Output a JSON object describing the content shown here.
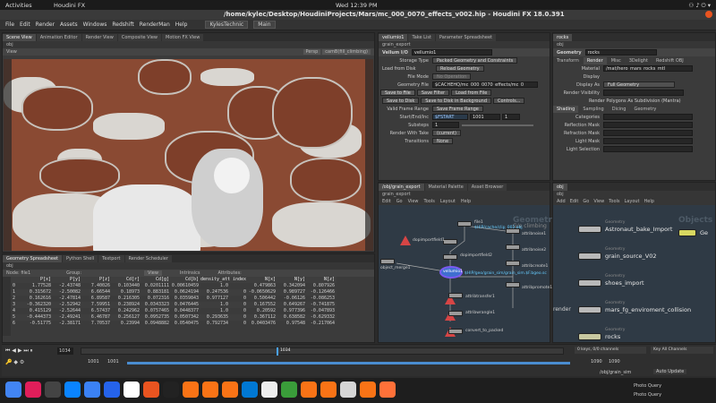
{
  "system": {
    "activities": "Activities",
    "app_name": "Houdini FX",
    "clock": "Wed 12:39 PM"
  },
  "window": {
    "title": "/home/kylec/Desktop/HoudiniProjects/Mars/mc_000_0070_effects_v002.hip - Houdini FX 18.0.391"
  },
  "menu": {
    "items": [
      "File",
      "Edit",
      "Render",
      "Assets",
      "Windows",
      "Redshift",
      "RenderMan",
      "Help"
    ],
    "desktop": "KylesTechnic",
    "desktop2": "Main"
  },
  "viewport_pane": {
    "tabs": [
      "Scene View",
      "Animation Editor",
      "Render View",
      "Composite View",
      "Motion FX View"
    ],
    "path": "obj",
    "header": "View",
    "persp": "Persp",
    "camera": "camB(fill_climbing)"
  },
  "spreadsheet": {
    "tabs": [
      "Geometry Spreadsheet",
      "Python Shell",
      "Textport",
      "Render Scheduler"
    ],
    "path": "obj",
    "node_label": "Node: file1",
    "group_label": "Group:",
    "view_label": "View",
    "intrinsics_label": "Intrinsics",
    "attributes_label": "Attributes:",
    "columns": [
      "",
      "P[x]",
      "P[y]",
      "P[z]",
      "Cd[r]",
      "Cd[g]",
      "Cd[b]",
      "density_attrib",
      "index",
      "N[x]",
      "N[y]",
      "N[z]"
    ],
    "rows": [
      [
        "0",
        "1.77528",
        "-2.43748",
        "7.40026",
        "0.103440",
        "0.0201111",
        "0.00610459",
        "1.0",
        "",
        "0.479863",
        "0.342094",
        "0.807926"
      ],
      [
        "1",
        "0.315672",
        "-2.50082",
        "6.66544",
        "0.18973",
        "0.883181",
        "0.0624194",
        "0.247536",
        "0",
        "-0.0650629",
        "0.989727",
        "-0.126466"
      ],
      [
        "2",
        "0.162616",
        "-2.47814",
        "6.89587",
        "0.216305",
        "0.072316",
        "0.0359843",
        "0.977127",
        "0",
        "0.506442",
        "-0.06126",
        "-0.086253"
      ],
      [
        "3",
        "-0.362320",
        "-2.52942",
        "7.59951",
        "0.238924",
        "0.0343323",
        "0.0476445",
        "1.0",
        "0",
        "0.167552",
        "0.649267",
        "-0.741875"
      ],
      [
        "4",
        "0.415129",
        "-2.52644",
        "6.57437",
        "0.242962",
        "0.0757465",
        "0.0448377",
        "1.0",
        "0",
        "0.20592",
        "0.977396",
        "-0.047893"
      ],
      [
        "5",
        "-0.444373",
        "-2.49241",
        "6.46787",
        "0.256127",
        "0.0952735",
        "0.0507342",
        "0.293635",
        "0",
        "0.367112",
        "0.638582",
        "-0.629332"
      ],
      [
        "6",
        "-0.51775",
        "-2.38171",
        "7.70537",
        "0.23994",
        "0.0948882",
        "0.0540475",
        "0.792734",
        "0",
        "0.0403476",
        "0.97548",
        "-0.217064"
      ]
    ]
  },
  "timeline": {
    "current_frame": "1034",
    "start": "1001",
    "start2": "1001",
    "end": "1090",
    "end2": "1090",
    "tick_marker": "1034",
    "keys": "0 keys, 0/0 channels",
    "key_all": "Key All Channels",
    "auto_update": "Auto Update",
    "path": "/obj/grain_sim"
  },
  "params": {
    "tabs": [
      "vellumio1",
      "Take List",
      "Parameter Spreadsheet"
    ],
    "path": "grain_export",
    "node_type": "Vellum I/O",
    "node_name": "vellumio1",
    "storage_type_label": "Storage Type",
    "storage_type": "Packed Geometry and Constraints",
    "load_from_disk": "Load from Disk",
    "reload_geometry": "Reload Geometry",
    "file_mode_label": "File Mode",
    "file_mode": "No Operation",
    "geometry_file_label": "Geometry File",
    "geometry_file": "$CACHEHQ/mc_000_0070_effects/mc_0",
    "save_to_file": "Save to File",
    "save_filter": "Save Filter",
    "load_from_file": "Load from File",
    "save_to_disk": "Save to Disk",
    "save_bg": "Save to Disk in Background",
    "controls": "Controls...",
    "valid_frame_label": "Valid Frame Range",
    "valid_frame": "Save Frame Range",
    "start_end_label": "Start/End/Inc",
    "start_expr": "$FSTART",
    "end_val": "1001",
    "inc_val": "1",
    "substeps_label": "Substeps",
    "substeps": "1",
    "render_take_label": "Render With Take",
    "render_take": "(current)",
    "transitions_label": "Transitions",
    "transitions": "None"
  },
  "material_pane": {
    "tabs": [
      "rocks"
    ],
    "path": "obj",
    "node_type": "Geometry",
    "node_name": "rocks",
    "subtabs": [
      "Transform",
      "Render",
      "Misc",
      "3Delight",
      "Redshift OBJ"
    ],
    "material_label": "Material",
    "material": "/mat/hero_mars_rocks_mtl",
    "display_label": "Display",
    "display_as_label": "Display As",
    "display_as": "Full Geometry",
    "render_vis_label": "Render Visibility",
    "render_poly": "Render Polygons As Subdivision (Mantra)",
    "shade_tabs": [
      "Shading",
      "Sampling",
      "Dicing",
      "Geometry"
    ],
    "categories_label": "Categories",
    "reflection_label": "Reflection Mask",
    "refraction_label": "Refraction Mask",
    "light_label": "Light Mask",
    "light_sel_label": "Light Selection"
  },
  "sop_network": {
    "tabs": [
      "/obj/grain_export",
      "Material Palette",
      "Asset Browser"
    ],
    "path": "grain_export",
    "menu": [
      "Edit",
      "Go",
      "View",
      "Tools",
      "Layout",
      "Help"
    ],
    "watermark": "Geometry",
    "watermark2": "G/e climbing",
    "nodes": [
      "file1",
      "dopimportfield1",
      "dopimportfield2",
      "vellumio1",
      "attribnoise1",
      "attribnoise2",
      "attribcreate1",
      "attribtransfer1",
      "attribpromote1",
      "attribwrangle1",
      "convert_to_packed",
      "object_merge1"
    ],
    "file1_sub": "$HIP/cache/clip_002.obj",
    "vellum_sub": "$HIP/geo/grain_sim/grain_sim.$F.bgeo.sc"
  },
  "obj_network": {
    "tabs": [
      "obj"
    ],
    "path": "obj",
    "menu": [
      "Add",
      "Edit",
      "Go",
      "View",
      "Tools",
      "Layout",
      "Help"
    ],
    "watermark": "Objects",
    "render_label": "render",
    "objects": [
      {
        "tag": "Geometry",
        "name": "Astronaut_bake_Import"
      },
      {
        "tag": "Geometry",
        "name": "grain_source_V02"
      },
      {
        "tag": "Geometry",
        "name": "shoes_import"
      },
      {
        "tag": "Geometry",
        "name": "mars_fg_enviroment_collision"
      },
      {
        "tag": "Geometry",
        "name": "rocks"
      }
    ],
    "floating_obj": "Ge"
  },
  "dock": {
    "icons": [
      "chrome-icon",
      "slack-icon",
      "terminal-icon",
      "thunderbird-icon",
      "files-icon",
      "docs-icon",
      "appstore-icon",
      "software-icon",
      "terminal2-icon",
      "houdini-icon",
      "houdini2-icon",
      "houdini3-icon",
      "vscode-icon",
      "text-icon",
      "calc-icon",
      "houdini4-icon",
      "houdini5-icon",
      "photo-icon",
      "houdini6-icon",
      "firefox-icon"
    ],
    "tooltip1": "Photo Query",
    "tooltip2": "Photo Query"
  }
}
